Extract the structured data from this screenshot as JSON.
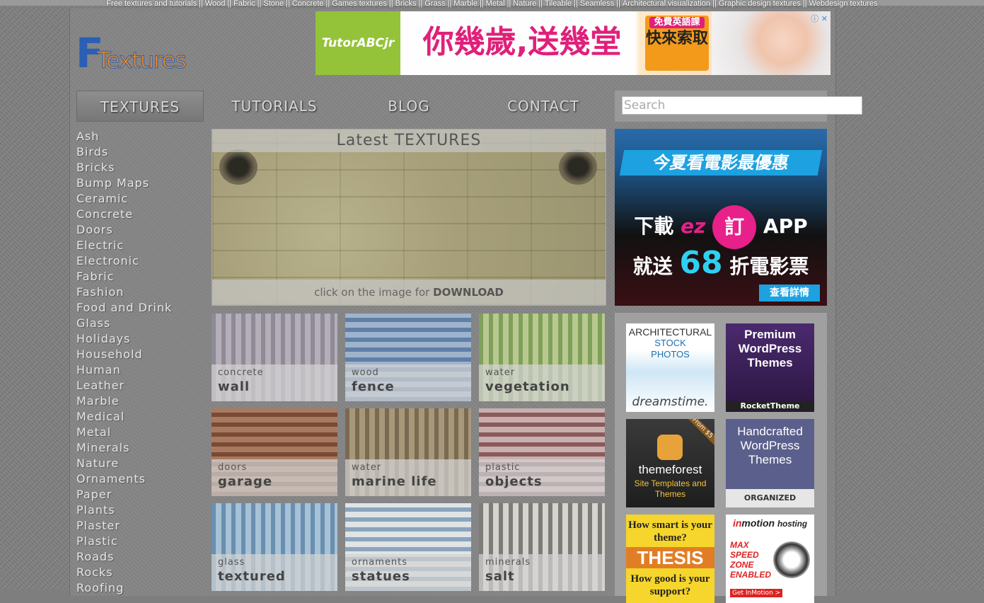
{
  "top_links": [
    "Free textures and tutorials",
    "Wood",
    "Fabric",
    "Stone",
    "Concrete",
    "Games textures",
    "Bricks",
    "Grass",
    "Marble",
    "Metal",
    "Nature",
    "Tileable",
    "Seamless",
    "Architectural visualization",
    "Graphic design textures",
    "Webdesign textures"
  ],
  "logo": {
    "first": "F",
    "rest": "Textures"
  },
  "top_ad": {
    "brand": "TutorABCjr",
    "headline": "你幾歲,送幾堂",
    "cta_small": "免費英語課",
    "cta_big": "快來索取",
    "icons": "ⓘ ✕"
  },
  "nav": {
    "items": [
      "TEXTURES",
      "TUTORIALS",
      "BLOG",
      "CONTACT"
    ],
    "search_placeholder": "Search"
  },
  "sidebar": {
    "items": [
      "Ash",
      "Birds",
      "Bricks",
      "Bump Maps",
      "Ceramic",
      "Concrete",
      "Doors",
      "Electric",
      "Electronic",
      "Fabric",
      "Fashion",
      "Food and Drink",
      "Glass",
      "Holidays",
      "Household",
      "Human",
      "Leather",
      "Marble",
      "Medical",
      "Metal",
      "Minerals",
      "Nature",
      "Ornaments",
      "Paper",
      "Plants",
      "Plaster",
      "Plastic",
      "Roads",
      "Rocks",
      "Roofing"
    ]
  },
  "featured": {
    "title": "Latest TEXTURES",
    "caption_prefix": "click on the image for",
    "caption_strong": "DOWNLOAD"
  },
  "tiles": [
    {
      "category": "concrete",
      "name": "wall",
      "color_a": "#8f8a96",
      "color_b": "#b3aeb8"
    },
    {
      "category": "wood",
      "name": "fence",
      "color_a": "#5f7fa8",
      "color_b": "#9fb4cc"
    },
    {
      "category": "water",
      "name": "vegetation",
      "color_a": "#7fa05a",
      "color_b": "#b9c890"
    },
    {
      "category": "doors",
      "name": "garage",
      "color_a": "#7a4a34",
      "color_b": "#a87a60"
    },
    {
      "category": "water",
      "name": "marine life",
      "color_a": "#7a6a52",
      "color_b": "#a8987a"
    },
    {
      "category": "plastic",
      "name": "objects",
      "color_a": "#8a5a5a",
      "color_b": "#c8b0b0"
    },
    {
      "category": "glass",
      "name": "textured",
      "color_a": "#6a8fb0",
      "color_b": "#a7c2d6"
    },
    {
      "category": "ornaments",
      "name": "statues",
      "color_a": "#8aa4bc",
      "color_b": "#e0e4e6"
    },
    {
      "category": "minerals",
      "name": "salt",
      "color_a": "#7e7c76",
      "color_b": "#d6d4ce"
    }
  ],
  "right_ad": {
    "line1": "今夏看電影最優惠",
    "line2_prefix": "下載",
    "line2_ez": "ez",
    "line2_pin": "訂",
    "line2_suffix": "APP",
    "line3_prefix": "就送",
    "line3_big": "68",
    "line3_suffix": "折電影票",
    "button": "查看詳情"
  },
  "sponsors": {
    "dreamstime": {
      "line1": "ARCHITECTURAL",
      "line2": "STOCK",
      "line3": "PHOTOS",
      "brand": "dreamstime."
    },
    "rockettheme": {
      "text": "Premium WordPress Themes",
      "brand": "RocketTheme"
    },
    "themeforest": {
      "corner": "From $5",
      "brand": "themeforest",
      "sub": "Site Templates and Themes"
    },
    "organized": {
      "text": "Handcrafted WordPress Themes",
      "brand": "ORGANIZED THEMES"
    },
    "thesis": {
      "q1": "How smart is your theme?",
      "big": "THESIS",
      "q2": "How good is your support?"
    },
    "inmotion": {
      "brand_a": "in",
      "brand_b": "motion",
      "sub": "hosting",
      "text": "MAX SPEED ZONE ENABLED",
      "btn": "Get InMotion >"
    }
  }
}
